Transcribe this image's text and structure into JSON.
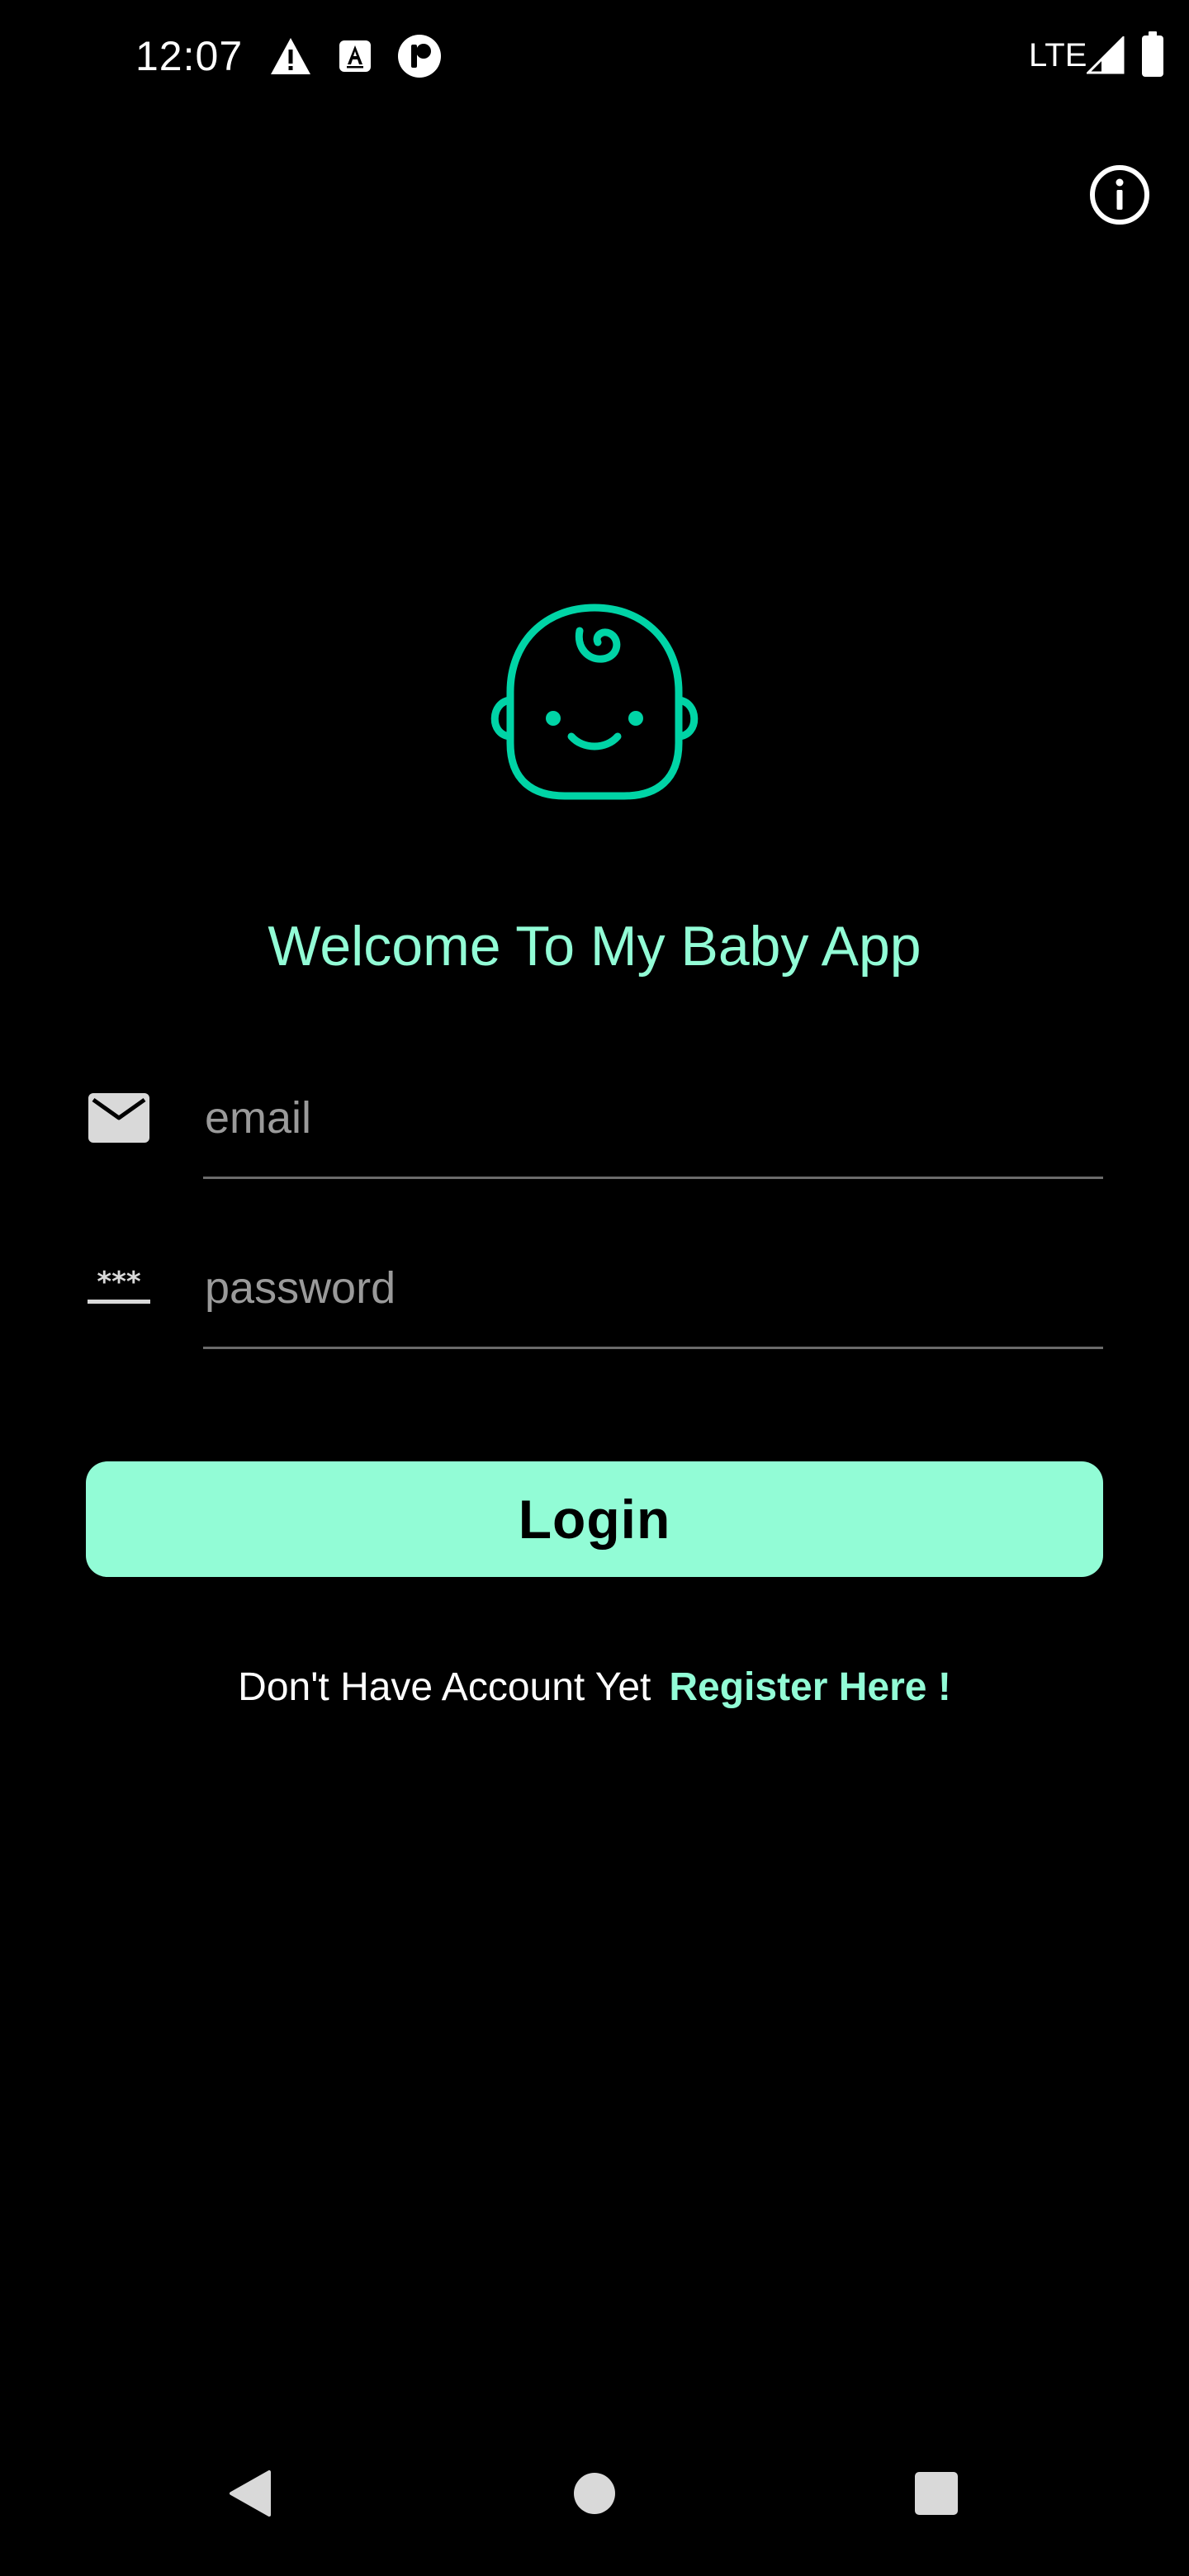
{
  "status_bar": {
    "time": "12:07",
    "left_icons": [
      "warning-icon",
      "font-a-icon",
      "app-indicator-icon"
    ],
    "network": "LTE",
    "right_icons": [
      "signal-icon",
      "battery-icon"
    ]
  },
  "toolbar": {
    "info_icon": "info-icon"
  },
  "logo": {
    "icon": "baby-face-icon",
    "color": "#00d4a6"
  },
  "welcome": {
    "title": "Welcome To My Baby App"
  },
  "form": {
    "email": {
      "icon": "mail-icon",
      "placeholder": "email",
      "value": ""
    },
    "password": {
      "icon": "password-icon",
      "placeholder": "password",
      "value": ""
    },
    "login_label": "Login"
  },
  "register": {
    "prompt": "Don't Have Account Yet",
    "link": "Register Here !"
  },
  "nav_bar": {
    "items": [
      "back-icon",
      "home-icon",
      "recents-icon"
    ]
  },
  "colors": {
    "background": "#000000",
    "accent": "#92fcd6",
    "logo": "#00d4a6",
    "text": "#ffffff",
    "placeholder": "#9a9a9a"
  }
}
